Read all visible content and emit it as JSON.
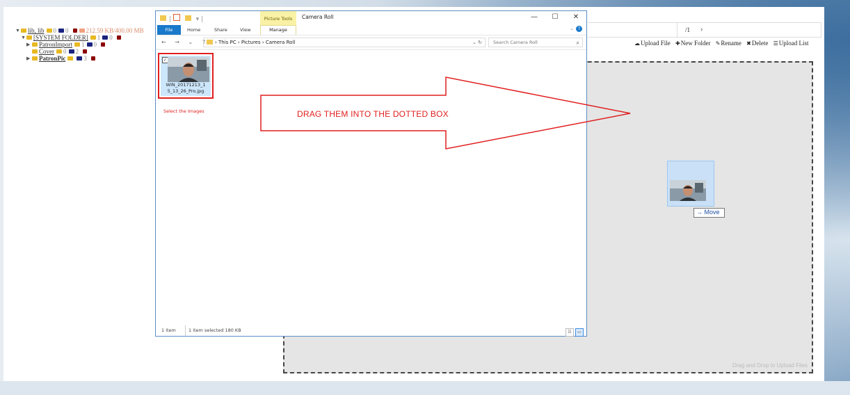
{
  "tree": {
    "root": {
      "label": "lib, lib",
      "folders_count": "0",
      "files_count": "0",
      "quota": "212.59 KB/400.00 MB"
    },
    "items": [
      {
        "label": "[SYSTEM FOLDER]",
        "folders_count": "1",
        "files_count": "0",
        "bold": false
      },
      {
        "label": "PatronImport",
        "folders_count": "1",
        "files_count": "0",
        "bold": false
      },
      {
        "label": "Cover",
        "folders_count": "0",
        "files_count": "2",
        "bold": false
      },
      {
        "label": "PatronPic",
        "folders_count": "",
        "files_count": "3",
        "bold": true
      }
    ]
  },
  "pager": {
    "page": "/1",
    "next": "›"
  },
  "actions": [
    {
      "icon": "upload-icon",
      "glyph": "☁",
      "label": "Upload File"
    },
    {
      "icon": "plus-icon",
      "glyph": "✚",
      "label": "New Folder"
    },
    {
      "icon": "edit-icon",
      "glyph": "✎",
      "label": "Rename"
    },
    {
      "icon": "delete-icon",
      "glyph": "✖",
      "label": "Delete"
    },
    {
      "icon": "list-icon",
      "glyph": "☰",
      "label": "Upload List"
    }
  ],
  "dropzone": {
    "hint": "Drag and Drop to Upload Files"
  },
  "drag": {
    "tooltip": "→ Move"
  },
  "explorer": {
    "context_tab": "Picture Tools",
    "title": "Camera Roll",
    "controls": {
      "minimize": "—",
      "maximize": "☐",
      "close": "✕"
    },
    "ribbon": {
      "file": "File",
      "home": "Home",
      "share": "Share",
      "view": "View",
      "manage": "Manage",
      "expand": "⌄",
      "help": "?"
    },
    "address": {
      "nav": "← → ⌄ ↑",
      "path": "›  This PC  ›  Pictures  ›  Camera Roll",
      "dropdown_refresh": "⌄ ↻"
    },
    "search_placeholder": "Search Camera Roll",
    "file": {
      "name": "WIN_20171213_15_13_26_Pro.jpg",
      "name_line1": "WIN_20171213_1",
      "name_line2": "5_13_26_Pro.jpg"
    },
    "status": {
      "count": "1 item",
      "selected": "1 item selected  180 KB"
    }
  },
  "annotations": {
    "select_hint": "Select the Images",
    "arrow_label": "DRAG THEM INTO THE DOTTED BOX"
  },
  "colors": {
    "annotation": "#e01e1e",
    "accent": "#1979ca",
    "folder": "#e8b923"
  }
}
